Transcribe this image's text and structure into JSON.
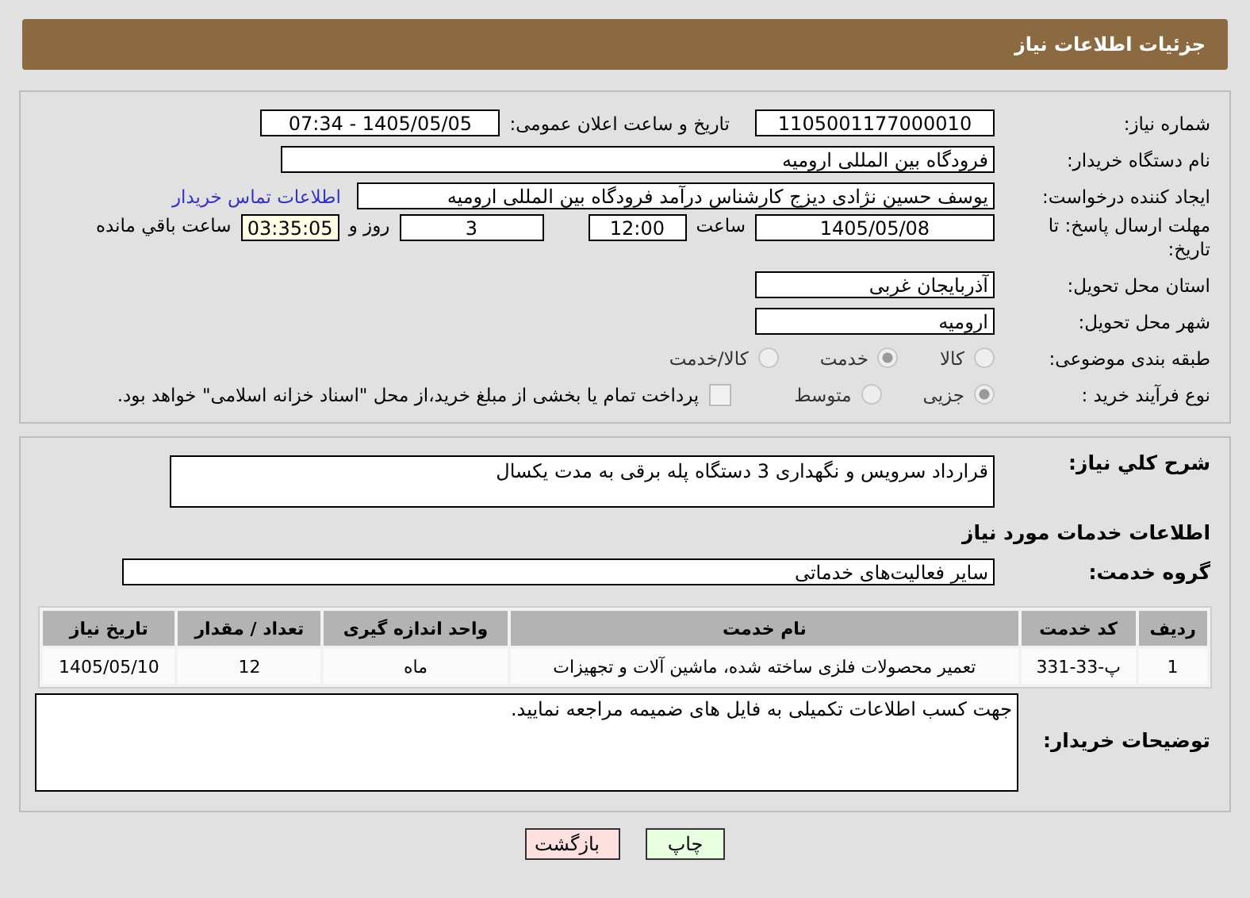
{
  "header": {
    "title": "جزئیات اطلاعات نیاز"
  },
  "need_number": {
    "label": "شماره نیاز:",
    "value": "1105001177000010"
  },
  "announce": {
    "label": "تاریخ و ساعت اعلان عمومی:",
    "value": "1405/05/05 - 07:34"
  },
  "buyer": {
    "label": "نام دستگاه خریدار:",
    "value": "فرودگاه بین المللی ارومیه"
  },
  "creator": {
    "label": "ایجاد کننده درخواست:",
    "value": "یوسف حسین نژادی دیزج کارشناس درآمد فرودگاه بین المللی ارومیه",
    "link": "اطلاعات تماس خریدار"
  },
  "deadline": {
    "label": "مهلت ارسال پاسخ: تا تاریخ:",
    "date": "1405/05/08",
    "time_label": "ساعت",
    "time": "12:00",
    "days": "3",
    "days_label": "روز و",
    "remaining": "03:35:05",
    "remaining_label": "ساعت باقي مانده"
  },
  "province": {
    "label": "استان محل تحویل:",
    "value": "آذربایجان غربی"
  },
  "city": {
    "label": "شهر محل تحویل:",
    "value": "ارومیه"
  },
  "category": {
    "label": "طبقه بندی موضوعی:",
    "options": [
      {
        "label": "کالا",
        "selected": false
      },
      {
        "label": "خدمت",
        "selected": true
      },
      {
        "label": "کالا/خدمت",
        "selected": false
      }
    ]
  },
  "process": {
    "label": "نوع فرآیند خرید :",
    "options": [
      {
        "label": "جزیی",
        "selected": true
      },
      {
        "label": "متوسط",
        "selected": false
      }
    ],
    "treasury": {
      "checked": false,
      "text": "پرداخت تمام یا بخشی از مبلغ خرید،از محل \"اسناد خزانه اسلامی\" خواهد بود."
    }
  },
  "summary": {
    "label": "شرح کلي نیاز:",
    "value": "قرارداد سرویس و نگهداری 3 دستگاه پله برقی به مدت یکسال"
  },
  "services_title": "اطلاعات خدمات مورد نیاز",
  "service_group": {
    "label": "گروه خدمت:",
    "value": "سایر فعالیت‌های خدماتی"
  },
  "table": {
    "columns": [
      "ردیف",
      "کد خدمت",
      "نام خدمت",
      "واحد اندازه گیری",
      "تعداد / مقدار",
      "تاریخ نیاز"
    ],
    "rows": [
      [
        "1",
        "پ-33-331",
        "تعمیر محصولات فلزی ساخته شده، ماشین آلات و تجهیزات",
        "ماه",
        "12",
        "1405/05/10"
      ]
    ]
  },
  "notes": {
    "label": "توضیحات خریدار:",
    "value": "جهت کسب اطلاعات تکمیلی به فایل های ضمیمه مراجعه نمایید."
  },
  "buttons": [
    {
      "kind": "print",
      "label": "چاپ"
    },
    {
      "kind": "back",
      "label": "بازگشت"
    }
  ]
}
